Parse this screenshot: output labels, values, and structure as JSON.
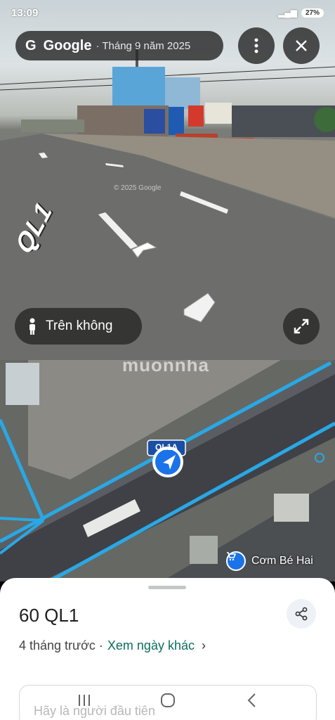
{
  "status_bar": {
    "time": "13:09",
    "battery": "27%"
  },
  "street_view": {
    "brand": "Google",
    "capture_date": "· Tháng 9 năm 2025",
    "aerial_label": "Trên không",
    "road_label": "QL1",
    "copyright": "© 2025 Google",
    "icons": {
      "more": "more-vert-icon",
      "close": "close-icon",
      "expand": "expand-icon",
      "person": "person-icon"
    }
  },
  "map": {
    "watermark": "muonnha",
    "road_shield": "QL1A",
    "place_name": "Cơm Bé Hai",
    "colors": {
      "road_outline": "#29a8e6",
      "heading": "#1a73e8"
    }
  },
  "sheet": {
    "title": "60 QL1",
    "time_ago": "4 tháng trước ·",
    "other_dates": "Xem ngày khác",
    "comment_placeholder": "Hãy là người đầu tiên"
  },
  "nav_bar": {
    "icons": [
      "recents-icon",
      "home-icon",
      "back-icon"
    ]
  }
}
